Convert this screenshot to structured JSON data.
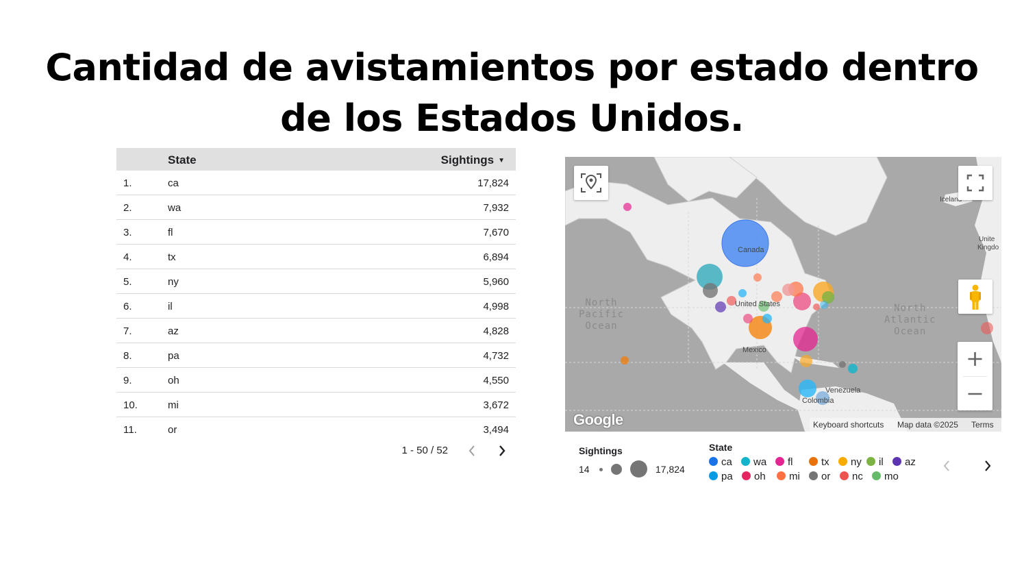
{
  "page": {
    "title_line1": "Cantidad de avistamientos por estado dentro",
    "title_line2": "de los Estados Unidos."
  },
  "table": {
    "col_state": "State",
    "col_sightings": "Sightings",
    "sort_indicator": "▼",
    "rows": [
      {
        "num": "1.",
        "state": "ca",
        "sightings": "17,824"
      },
      {
        "num": "2.",
        "state": "wa",
        "sightings": "7,932"
      },
      {
        "num": "3.",
        "state": "fl",
        "sightings": "7,670"
      },
      {
        "num": "4.",
        "state": "tx",
        "sightings": "6,894"
      },
      {
        "num": "5.",
        "state": "ny",
        "sightings": "5,960"
      },
      {
        "num": "6.",
        "state": "il",
        "sightings": "4,998"
      },
      {
        "num": "7.",
        "state": "az",
        "sightings": "4,828"
      },
      {
        "num": "8.",
        "state": "pa",
        "sightings": "4,732"
      },
      {
        "num": "9.",
        "state": "oh",
        "sightings": "4,550"
      },
      {
        "num": "10.",
        "state": "mi",
        "sightings": "3,672"
      },
      {
        "num": "11.",
        "state": "or",
        "sightings": "3,494"
      }
    ],
    "pagination": "1 - 50 / 52"
  },
  "map": {
    "labels": {
      "canada": "Canada",
      "united_states": "United States",
      "mexico": "Mexico",
      "venezuela": "Venezuela",
      "colombia": "Colombia",
      "iceland": "Iceland",
      "united_kingdom_1": "Unite",
      "united_kingdom_2": "Kingdo",
      "north_pacific": [
        "North",
        "Pacific",
        "Ocean"
      ],
      "north_atlantic": [
        "North",
        "Atlantic",
        "Ocean"
      ]
    },
    "google_logo": "Google",
    "keyboard_shortcuts": "Keyboard shortcuts",
    "map_data": "Map data ©2025",
    "terms": "Terms",
    "bubbles": [
      {
        "label": "ca",
        "color": "#4285f4",
        "value": 17824
      },
      {
        "label": "wa",
        "color": "#26a69a",
        "value": 7932
      },
      {
        "label": "fl",
        "color": "#e91e8c",
        "value": 7670
      },
      {
        "label": "tx",
        "color": "#f57c00",
        "value": 6894
      },
      {
        "label": "ny",
        "color": "#f9a825",
        "value": 5960
      },
      {
        "label": "il",
        "color": "#7cb342",
        "value": 4998
      },
      {
        "label": "az",
        "color": "#5e35b1",
        "value": 4828
      },
      {
        "label": "pa",
        "color": "#29b6f6",
        "value": 4732
      },
      {
        "label": "oh",
        "color": "#ec407a",
        "value": 4550
      },
      {
        "label": "mi",
        "color": "#ff7043",
        "value": 3672
      },
      {
        "label": "or",
        "color": "#757575",
        "value": 3494
      }
    ]
  },
  "legend": {
    "size_title": "Sightings",
    "size_min": "14",
    "size_max": "17,824",
    "state_title": "State",
    "items": [
      {
        "label": "ca",
        "color": "#1a73e8"
      },
      {
        "label": "wa",
        "color": "#12b5cb"
      },
      {
        "label": "fl",
        "color": "#e52592"
      },
      {
        "label": "tx",
        "color": "#e8710a"
      },
      {
        "label": "ny",
        "color": "#f9ab00"
      },
      {
        "label": "il",
        "color": "#7cb342"
      },
      {
        "label": "az",
        "color": "#5e35b1"
      },
      {
        "label": "pa",
        "color": "#039be5"
      },
      {
        "label": "oh",
        "color": "#e52560"
      },
      {
        "label": "mi",
        "color": "#ff7043"
      },
      {
        "label": "or",
        "color": "#757575"
      },
      {
        "label": "nc",
        "color": "#ef5350"
      },
      {
        "label": "mo",
        "color": "#66bb6a"
      }
    ]
  }
}
